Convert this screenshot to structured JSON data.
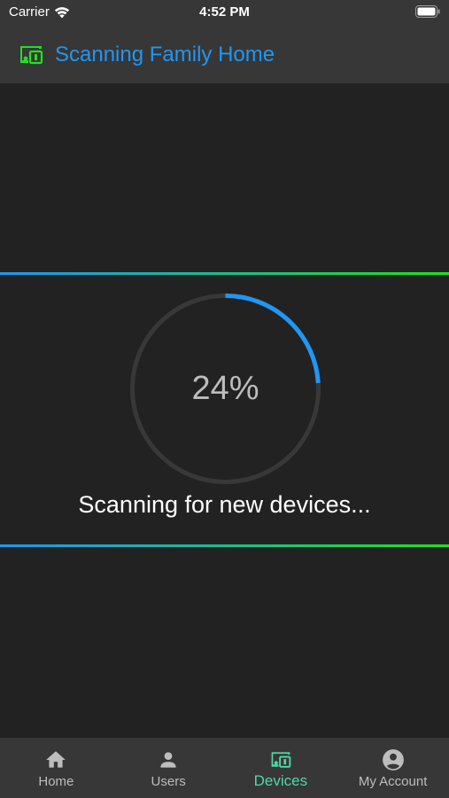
{
  "status_bar": {
    "carrier": "Carrier",
    "time": "4:52 PM"
  },
  "header": {
    "title": "Scanning Family Home",
    "logo_icon": "devices-icon",
    "title_color": "#2196f3",
    "logo_color": "#21e021"
  },
  "scan": {
    "progress": 0.24,
    "percent_label": "24%",
    "message": "Scanning for new devices...",
    "ring_color": "#2196f3"
  },
  "tabs": [
    {
      "label": "Home",
      "icon": "home-icon",
      "active": false
    },
    {
      "label": "Users",
      "icon": "user-icon",
      "active": false
    },
    {
      "label": "Devices",
      "icon": "devices-icon",
      "active": true
    },
    {
      "label": "My Account",
      "icon": "account-circle-icon",
      "active": false
    }
  ],
  "colors": {
    "background": "#222222",
    "bar": "#373737",
    "active_tab": "#4dd9a8",
    "inactive_tab": "#bdbdbd"
  }
}
